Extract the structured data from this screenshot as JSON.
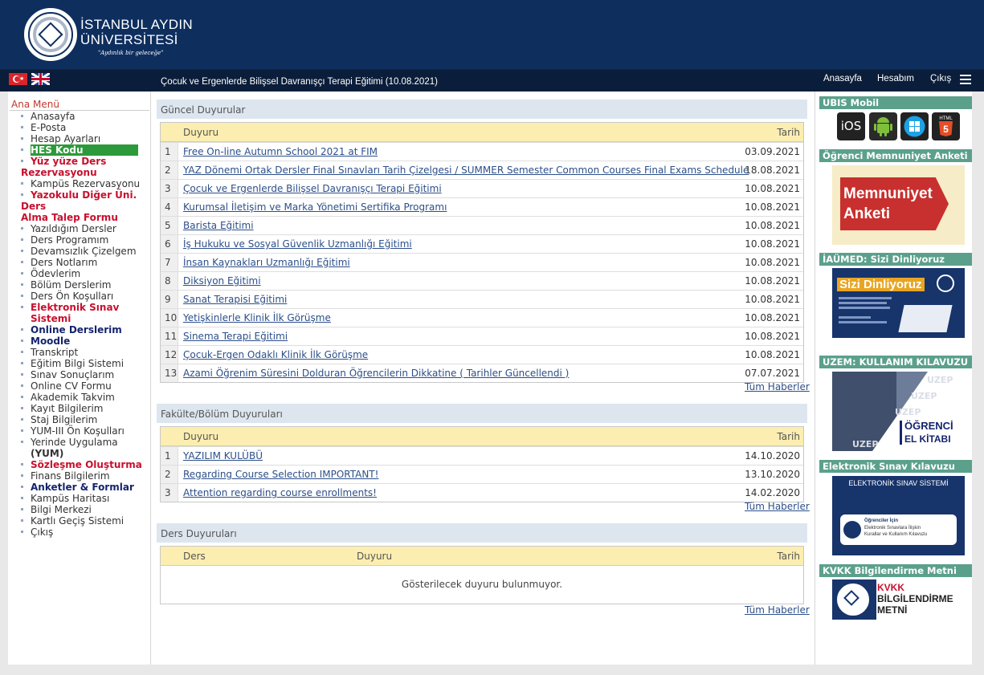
{
  "header": {
    "uni_line1": "İSTANBUL AYDIN",
    "uni_line2": "ÜNİVERSİTESİ",
    "slogan": "\"Aydınlık bir geleceğe\""
  },
  "topbar": {
    "page_title": "Çocuk ve Ergenlerde Bilişsel Davranışçı Terapi Eğitimi (10.08.2021)",
    "links": [
      "Anasayfa",
      "Hesabım",
      "Çıkış"
    ]
  },
  "leftnav": {
    "title": "Ana Menü",
    "items": [
      {
        "label": "Anasayfa",
        "style": "normal"
      },
      {
        "label": "E-Posta",
        "style": "normal"
      },
      {
        "label": "Hesap Ayarları",
        "style": "normal"
      },
      {
        "label": "HES Kodu",
        "style": "hes"
      },
      {
        "label": "Yüz yüze Ders",
        "label2": "Rezervasyonu",
        "style": "red"
      },
      {
        "label": "Kampüs Rezervasyonu",
        "style": "normal"
      },
      {
        "label": "Yazokulu Diğer Üni. Ders",
        "label2": "Alma Talep Formu",
        "style": "red"
      },
      {
        "label": "Yazıldığım Dersler",
        "style": "normal"
      },
      {
        "label": "Ders Programım",
        "style": "normal"
      },
      {
        "label": "Devamsızlık Çizelgem",
        "style": "normal"
      },
      {
        "label": "Ders Notlarım",
        "style": "normal"
      },
      {
        "label": "Ödevlerim",
        "style": "normal"
      },
      {
        "label": "Bölüm Derslerim",
        "style": "normal"
      },
      {
        "label": "Ders Ön Koşulları",
        "style": "normal"
      },
      {
        "label": "Elektronik Sınav Sistemi",
        "style": "red"
      },
      {
        "label": "Online Derslerim",
        "style": "navy"
      },
      {
        "label": "Moodle",
        "style": "navy"
      },
      {
        "label": "Transkript",
        "style": "normal"
      },
      {
        "label": "Eğitim Bilgi Sistemi",
        "style": "normal"
      },
      {
        "label": "Sınav Sonuçlarım",
        "style": "normal"
      },
      {
        "label": "Online CV Formu",
        "style": "normal"
      },
      {
        "label": "Akademik Takvim",
        "style": "normal"
      },
      {
        "label": "Kayıt Bilgilerim",
        "style": "normal"
      },
      {
        "label": "Staj Bilgilerim",
        "style": "normal"
      },
      {
        "label": "YUM-III Ön Koşulları",
        "style": "normal"
      },
      {
        "label": "Yerinde Uygulama",
        "bold": "(YUM)",
        "style": "normal"
      },
      {
        "label": "Sözleşme Oluşturma",
        "style": "red"
      },
      {
        "label": "Finans Bilgilerim",
        "style": "normal"
      },
      {
        "label": "Anketler & Formlar",
        "style": "navy"
      },
      {
        "label": "Kampüs Haritası",
        "style": "normal"
      },
      {
        "label": "Bilgi Merkezi",
        "style": "normal"
      },
      {
        "label": "Kartlı Geçiş Sistemi",
        "style": "normal"
      },
      {
        "label": "Çıkış",
        "style": "normal"
      }
    ]
  },
  "guncel": {
    "section_title": "Güncel Duyurular",
    "col_title": "Duyuru",
    "col_date": "Tarih",
    "rows": [
      {
        "n": "1",
        "title": "Free On-line Autumn School 2021 at FIM",
        "date": "03.09.2021"
      },
      {
        "n": "2",
        "title": "YAZ Dönemi Ortak Dersler Final Sınavları Tarih Çizelgesi / SUMMER Semester Common Courses Final Exams Schedule",
        "date": "18.08.2021"
      },
      {
        "n": "3",
        "title": "Çocuk ve Ergenlerde Bilişsel Davranışçı Terapi Eğitimi",
        "date": "10.08.2021"
      },
      {
        "n": "4",
        "title": "Kurumsal İletişim ve Marka Yönetimi Sertifika Programı",
        "date": "10.08.2021"
      },
      {
        "n": "5",
        "title": "Barista Eğitimi",
        "date": "10.08.2021"
      },
      {
        "n": "6",
        "title": "İş Hukuku ve Sosyal Güvenlik Uzmanlığı Eğitimi",
        "date": "10.08.2021"
      },
      {
        "n": "7",
        "title": "İnsan Kaynakları Uzmanlığı Eğitimi",
        "date": "10.08.2021"
      },
      {
        "n": "8",
        "title": "Diksiyon Eğitimi",
        "date": "10.08.2021"
      },
      {
        "n": "9",
        "title": "Sanat Terapisi Eğitimi",
        "date": "10.08.2021"
      },
      {
        "n": "10",
        "title": "Yetişkinlerle Klinik İlk Görüşme",
        "date": "10.08.2021"
      },
      {
        "n": "11",
        "title": "Sinema Terapi Eğitimi",
        "date": "10.08.2021"
      },
      {
        "n": "12",
        "title": "Çocuk-Ergen Odaklı Klinik İlk Görüşme",
        "date": "10.08.2021"
      },
      {
        "n": "13",
        "title": "Azami Öğrenim Süresini Dolduran Öğrencilerin Dikkatine ( Tarihler Güncellendi )",
        "date": "07.07.2021"
      }
    ],
    "all_news": "Tüm Haberler"
  },
  "fakulte": {
    "section_title": "Fakülte/Bölüm Duyuruları",
    "col_title": "Duyuru",
    "col_date": "Tarih",
    "rows": [
      {
        "n": "1",
        "title": "YAZILIM KULÜBÜ",
        "date": "14.10.2020"
      },
      {
        "n": "2",
        "title": "Regarding Course Selection IMPORTANT!",
        "date": "13.10.2020"
      },
      {
        "n": "3",
        "title": "Attention regarding course enrollments!",
        "date": "14.02.2020"
      }
    ],
    "all_news": "Tüm Haberler"
  },
  "ders": {
    "section_title": "Ders Duyuruları",
    "col_course": "Ders",
    "col_title": "Duyuru",
    "col_date": "Tarih",
    "empty": "Gösterilecek duyuru bulunmuyor.",
    "all_news": "Tüm Haberler"
  },
  "rightbar": {
    "ubis_title": "UBIS Mobil",
    "apps": [
      "iOS",
      "Android",
      "Windows",
      "HTML5"
    ],
    "html5_label": "HTML",
    "html5_num": "5",
    "anket_title": "Öğrenci Memnuniyet Anketi",
    "anket_line1": "Memnuniyet",
    "anket_line2": "Anketi",
    "iaumed_title": "İAÜMED: Sizi Dinliyoruz",
    "iaumed_banner": "Sizi Dinliyoruz",
    "uzem_title": "UZEM: KULLANIM KILAVUZU",
    "uzem_line1": "ÖĞRENCİ",
    "uzem_line2": "EL KİTABI",
    "uzem_watermark": "UZEP",
    "esinav_title": "Elektronik Sınav Kılavuzu",
    "esinav_heading": "ELEKTRONİK SINAV SİSTEMİ",
    "esinav_card1": "Öğrenciler İçin",
    "esinav_card2": "Elektronik Sınavlara İlişkin",
    "esinav_card3": "Kurallar ve Kullanım Kılavuzu",
    "kvkk_title": "KVKK Bilgilendirme Metni",
    "kvkk_line1": "KVKK",
    "kvkk_line2": "BİLGİLENDİRME",
    "kvkk_line3": "METNİ"
  },
  "colors": {
    "header_bg": "#0e2e5e",
    "topbar_bg": "#0a1d3a",
    "table_head_bg": "#fbeeb0",
    "section_bg": "#dde6ef",
    "right_head_bg": "#5ba08b",
    "link": "#2c4f8a",
    "hes_green": "#2c9a3a",
    "menu_red": "#c8102e",
    "menu_navy": "#16246e"
  }
}
